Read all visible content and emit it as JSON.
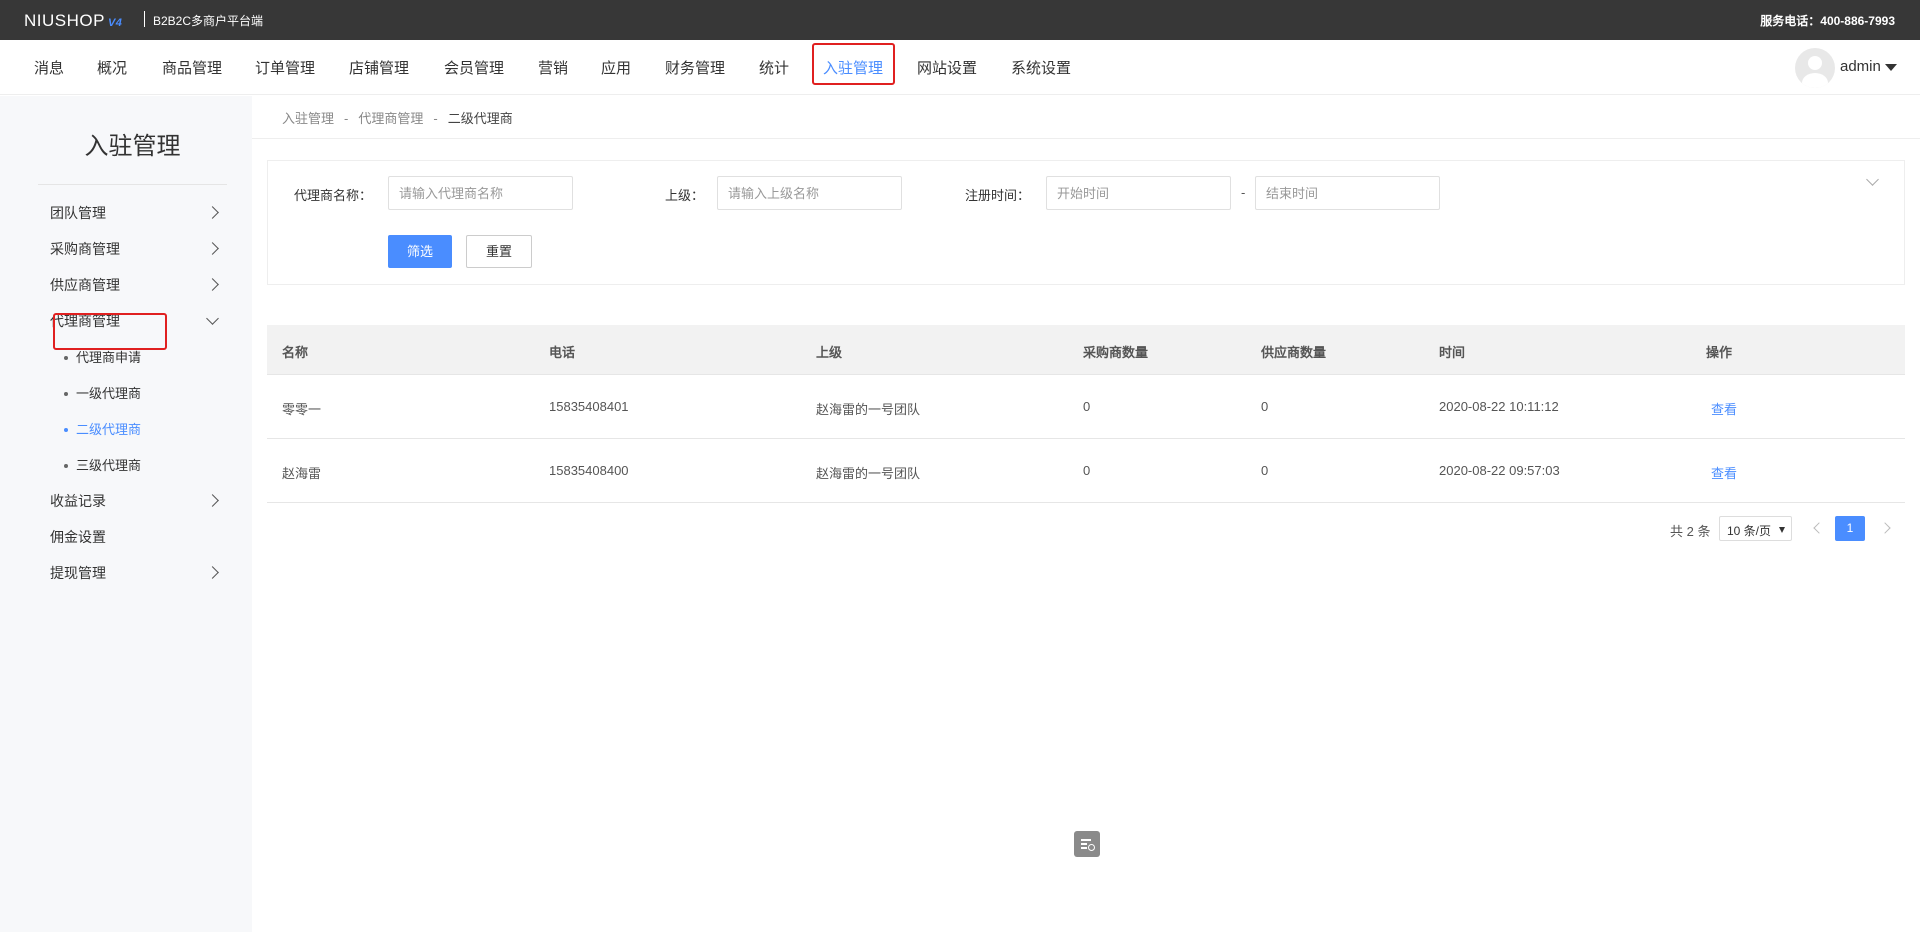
{
  "topbar": {
    "logo": "NIUSHOP",
    "logo_version": "V4",
    "subtitle": "B2B2C多商户平台端",
    "hotline": "服务电话：400-886-7993"
  },
  "nav": {
    "items": [
      "消息",
      "概况",
      "商品管理",
      "订单管理",
      "店铺管理",
      "会员管理",
      "营销",
      "应用",
      "财务管理",
      "统计",
      "入驻管理",
      "网站设置",
      "系统设置"
    ],
    "active": "入驻管理",
    "user": "admin"
  },
  "sidebar": {
    "title": "入驻管理",
    "items": {
      "team": "团队管理",
      "purchaser": "采购商管理",
      "supplier": "供应商管理",
      "agent": "代理商管理",
      "income": "收益记录",
      "commission": "佣金设置",
      "withdraw": "提现管理"
    },
    "agent_sub": [
      "代理商申请",
      "一级代理商",
      "二级代理商",
      "三级代理商"
    ],
    "active_sub": "二级代理商"
  },
  "breadcrumb": [
    "入驻管理",
    "代理商管理",
    "二级代理商"
  ],
  "breadcrumb_sep": "-",
  "filter": {
    "name_label": "代理商名称：",
    "name_placeholder": "请输入代理商名称",
    "parent_label": "上级：",
    "parent_placeholder": "请输入上级名称",
    "time_label": "注册时间：",
    "start_placeholder": "开始时间",
    "end_placeholder": "结束时间",
    "dash": "-",
    "filter_button": "筛选",
    "reset_button": "重置"
  },
  "table": {
    "headers": [
      "名称",
      "电话",
      "上级",
      "采购商数量",
      "供应商数量",
      "时间",
      "操作"
    ],
    "rows": [
      {
        "name": "零零一",
        "phone": "15835408401",
        "parent": "赵海雷的一号团队",
        "purchasers": "0",
        "suppliers": "0",
        "time": "2020-08-22 10:11:12",
        "action": "查看"
      },
      {
        "name": "赵海雷",
        "phone": "15835408400",
        "parent": "赵海雷的一号团队",
        "purchasers": "0",
        "suppliers": "0",
        "time": "2020-08-22 09:57:03",
        "action": "查看"
      }
    ]
  },
  "pagination": {
    "total": "共 2 条",
    "page_size": "10 条/页",
    "current_page": "1"
  },
  "colors": {
    "accent": "#4a8dff",
    "topbar": "#373737",
    "highlight_box": "#e02020"
  }
}
